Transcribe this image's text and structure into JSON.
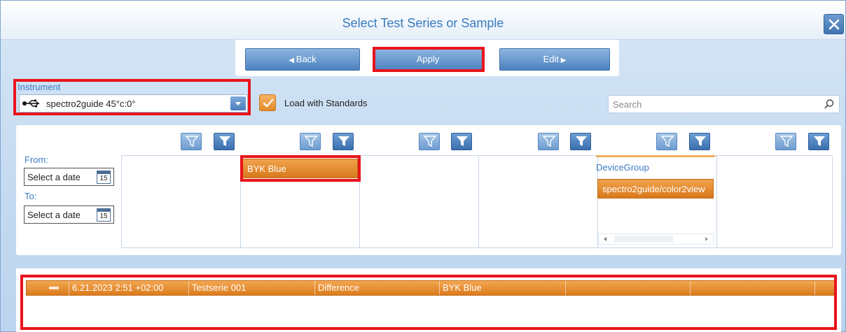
{
  "window": {
    "title": "Select Test Series or Sample",
    "close_icon": "close-icon"
  },
  "toolbar": {
    "back_label": "Back",
    "apply_label": "Apply",
    "edit_label": "Edit"
  },
  "instrument": {
    "label": "Instrument",
    "selected": "spectro2guide 45°c:0°",
    "icon": "usb-icon"
  },
  "load_standards": {
    "label": "Load with Standards",
    "checked": true
  },
  "search": {
    "placeholder": "Search",
    "value": ""
  },
  "filters": {
    "from_label": "From:",
    "to_label": "To:",
    "from_placeholder": "Select a date",
    "to_placeholder": "Select a date",
    "calendar_day": "15",
    "columns": [
      {
        "selected_item": ""
      },
      {
        "selected_item": "BYK Blue"
      },
      {
        "selected_item": ""
      },
      {
        "selected_item": ""
      },
      {
        "header": "DeviceGroup",
        "selected_item": "spectro2guide/color2view"
      },
      {
        "selected_item": ""
      }
    ]
  },
  "results": {
    "rows": [
      {
        "datetime": "6.21.2023 2:51 +02:00",
        "series": "Testserie 001",
        "mode": "Difference",
        "standard": "BYK Blue",
        "col5": "",
        "col6": "",
        "col7": ""
      }
    ]
  },
  "colors": {
    "accent_blue": "#4d82bf",
    "selection_orange": "#db7b1c",
    "highlight_red": "#e8141b"
  }
}
